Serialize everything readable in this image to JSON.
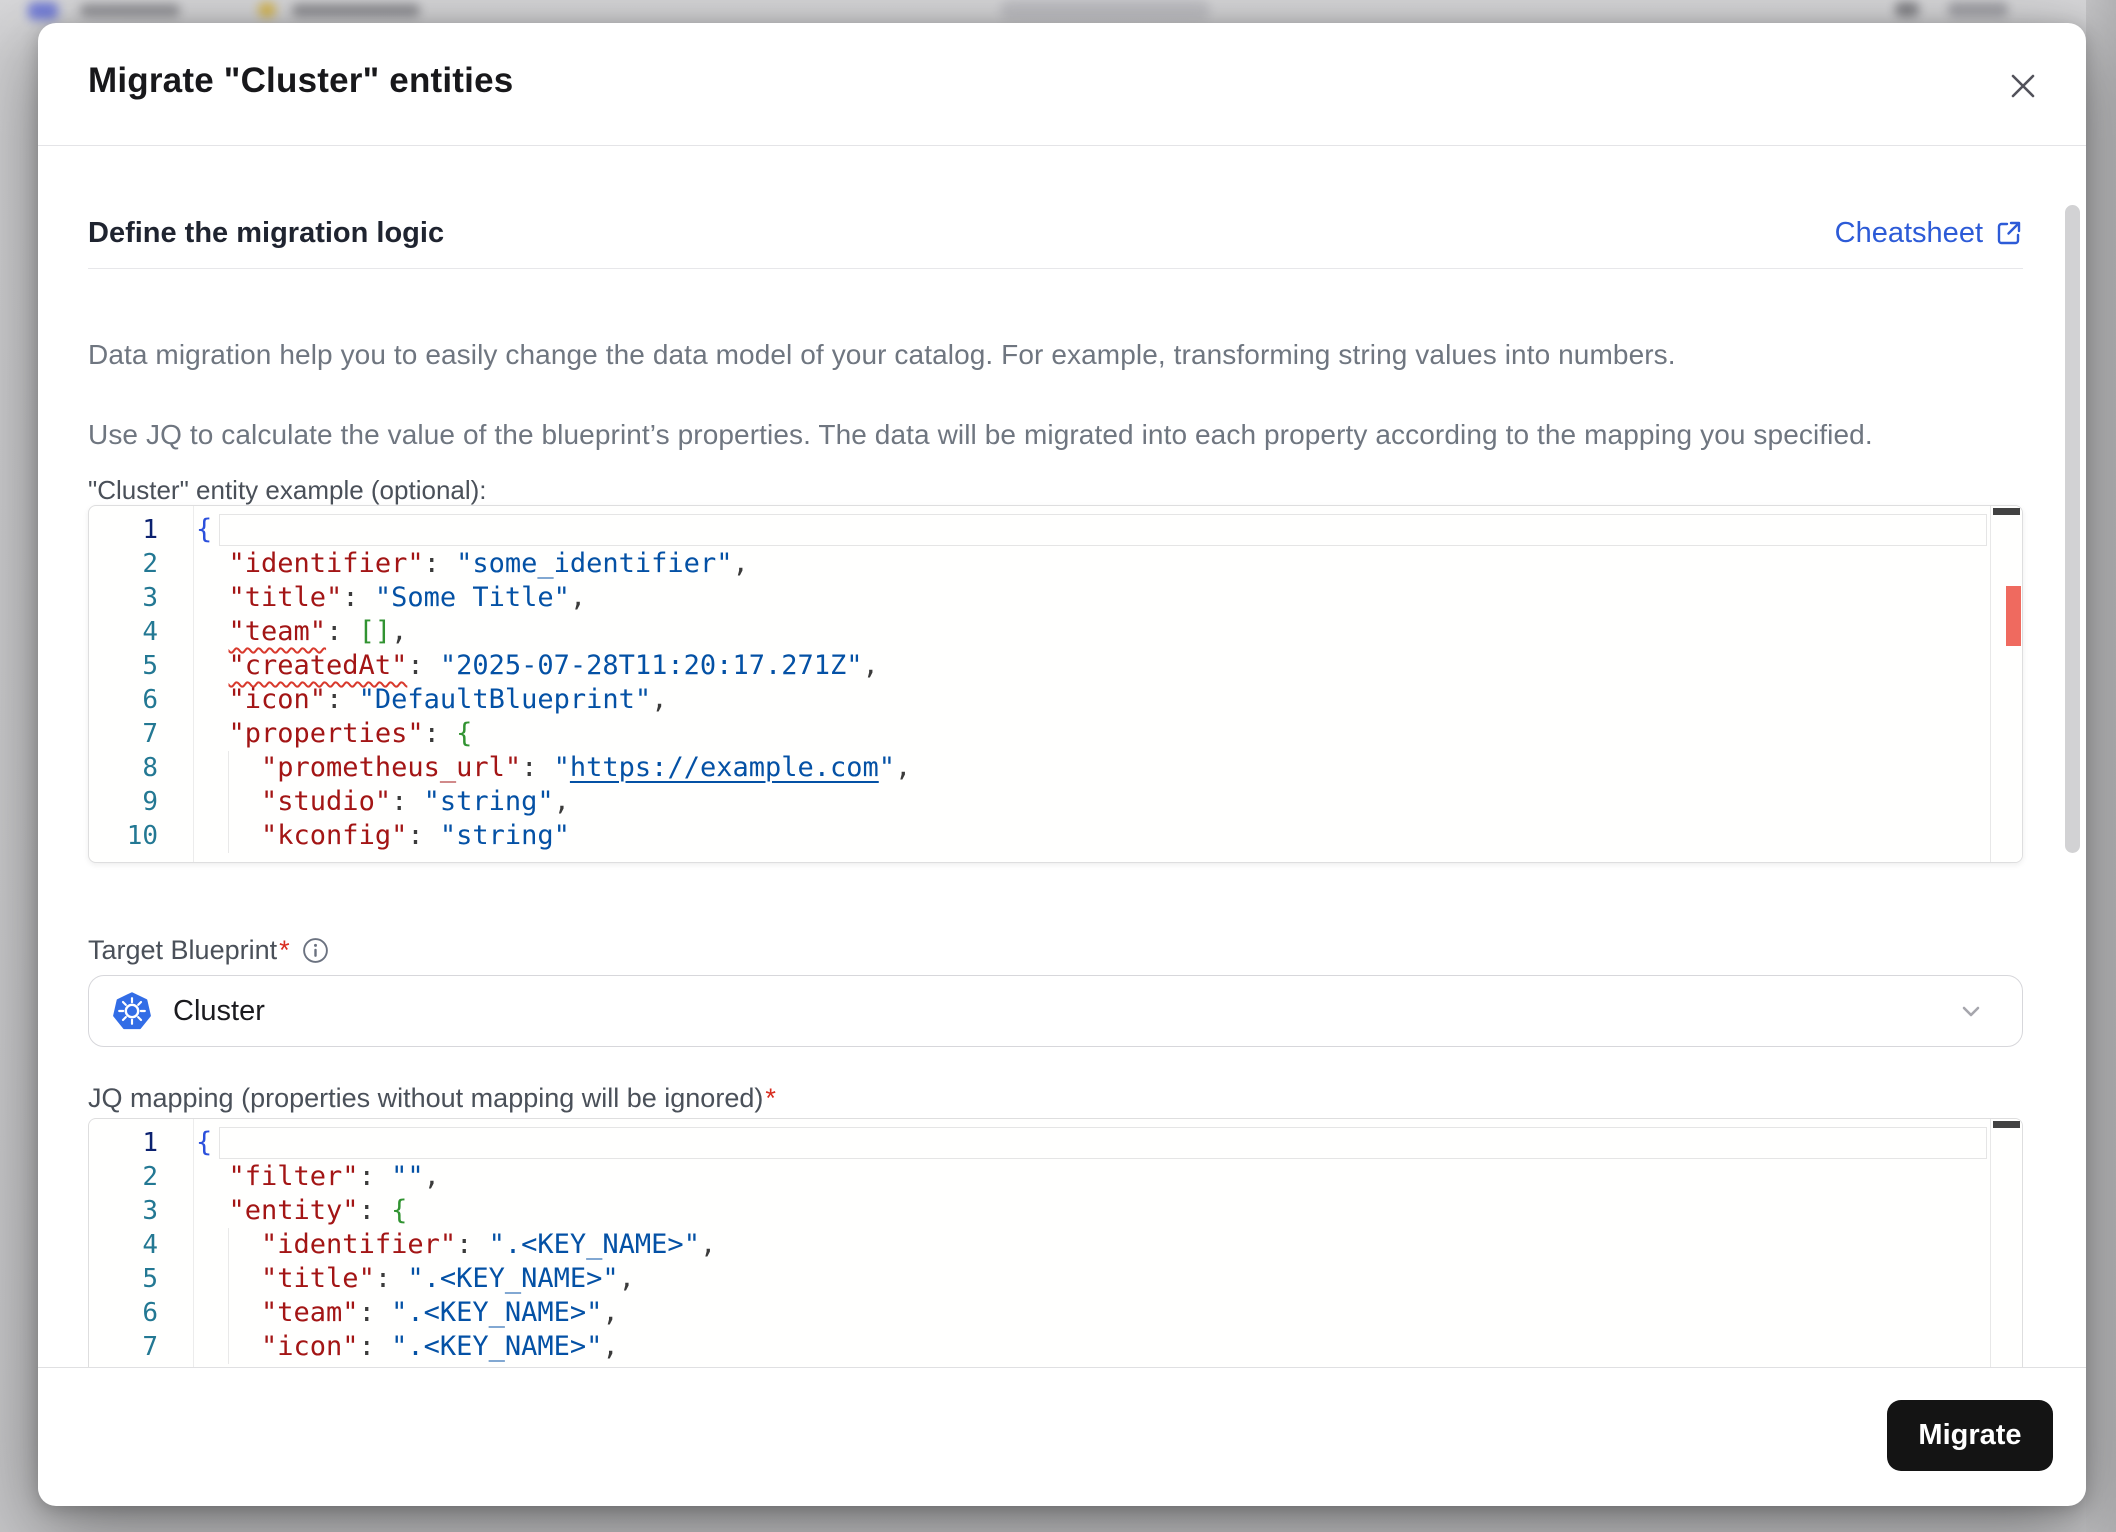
{
  "modal": {
    "title": "Migrate \"Cluster\" entities"
  },
  "section": {
    "heading": "Define the migration logic",
    "cheatsheet_label": "Cheatsheet"
  },
  "description": {
    "paragraph1": "Data migration help you to easily change the data model of your catalog. For example, transforming string values into numbers.",
    "paragraph2": "Use JQ to calculate the value of the blueprint’s properties. The data will be migrated into each property according to the mapping you specified."
  },
  "target_blueprint": {
    "label": "Target Blueprint",
    "required_marker": "*",
    "value": "Cluster",
    "icon": "kubernetes-icon"
  },
  "jq_mapping": {
    "label": "JQ mapping (properties without mapping will be ignored)",
    "required_marker": "*"
  },
  "footer": {
    "migrate_label": "Migrate"
  },
  "colors": {
    "link_blue": "#2d5bd7",
    "button_black": "#141414",
    "kubernetes_blue": "#326de6",
    "json_key_red": "#a31515",
    "json_string_blue": "#0451a5",
    "bracket_level1_blue": "#2b50dc",
    "bracket_level2_green": "#319331",
    "squiggle_red": "#d8392c",
    "error_marker_red": "#ef6a5f",
    "required_red": "#d92d20"
  },
  "editors": {
    "example": {
      "label": "\"Cluster\" entity example (optional):",
      "has_error_marker": true,
      "lines": [
        {
          "n": "1",
          "current": true,
          "tokens": [
            [
              "b0",
              "{"
            ]
          ]
        },
        {
          "n": "2",
          "tokens": [
            [
              "pu",
              "  "
            ],
            [
              "k",
              "\"identifier\""
            ],
            [
              "pu",
              ": "
            ],
            [
              "s",
              "\"some_identifier\""
            ],
            [
              "pu",
              ","
            ]
          ]
        },
        {
          "n": "3",
          "tokens": [
            [
              "pu",
              "  "
            ],
            [
              "k",
              "\"title\""
            ],
            [
              "pu",
              ": "
            ],
            [
              "s",
              "\"Some Title\""
            ],
            [
              "pu",
              ","
            ]
          ]
        },
        {
          "n": "4",
          "tokens": [
            [
              "pu",
              "  "
            ],
            [
              "ksq",
              "\"team\""
            ],
            [
              "pu",
              ": "
            ],
            [
              "b1",
              "[]"
            ],
            [
              "pu",
              ","
            ]
          ]
        },
        {
          "n": "5",
          "tokens": [
            [
              "pu",
              "  "
            ],
            [
              "ksq",
              "\"createdAt\""
            ],
            [
              "pu",
              ": "
            ],
            [
              "s",
              "\"2025-07-28T11:20:17.271Z\""
            ],
            [
              "pu",
              ","
            ]
          ]
        },
        {
          "n": "6",
          "tokens": [
            [
              "pu",
              "  "
            ],
            [
              "k",
              "\"icon\""
            ],
            [
              "pu",
              ": "
            ],
            [
              "s",
              "\"DefaultBlueprint\""
            ],
            [
              "pu",
              ","
            ]
          ]
        },
        {
          "n": "7",
          "tokens": [
            [
              "pu",
              "  "
            ],
            [
              "k",
              "\"properties\""
            ],
            [
              "pu",
              ": "
            ],
            [
              "b1",
              "{"
            ]
          ]
        },
        {
          "n": "8",
          "tokens": [
            [
              "pu",
              "    "
            ],
            [
              "k",
              "\"prometheus_url\""
            ],
            [
              "pu",
              ": "
            ],
            [
              "s",
              "\""
            ],
            [
              "slink",
              "https://example.com"
            ],
            [
              "s",
              "\""
            ],
            [
              "pu",
              ","
            ]
          ]
        },
        {
          "n": "9",
          "tokens": [
            [
              "pu",
              "    "
            ],
            [
              "k",
              "\"studio\""
            ],
            [
              "pu",
              ": "
            ],
            [
              "s",
              "\"string\""
            ],
            [
              "pu",
              ","
            ]
          ]
        },
        {
          "n": "10",
          "tokens": [
            [
              "pu",
              "    "
            ],
            [
              "k",
              "\"kconfig\""
            ],
            [
              "pu",
              ": "
            ],
            [
              "s",
              "\"string\""
            ]
          ]
        }
      ]
    },
    "jq": {
      "has_error_marker": false,
      "lines": [
        {
          "n": "1",
          "current": true,
          "tokens": [
            [
              "b0",
              "{"
            ]
          ]
        },
        {
          "n": "2",
          "tokens": [
            [
              "pu",
              "  "
            ],
            [
              "k",
              "\"filter\""
            ],
            [
              "pu",
              ": "
            ],
            [
              "s",
              "\"\""
            ],
            [
              "pu",
              ","
            ]
          ]
        },
        {
          "n": "3",
          "tokens": [
            [
              "pu",
              "  "
            ],
            [
              "k",
              "\"entity\""
            ],
            [
              "pu",
              ": "
            ],
            [
              "b1",
              "{"
            ]
          ]
        },
        {
          "n": "4",
          "tokens": [
            [
              "pu",
              "    "
            ],
            [
              "k",
              "\"identifier\""
            ],
            [
              "pu",
              ": "
            ],
            [
              "s",
              "\".<KEY_NAME>\""
            ],
            [
              "pu",
              ","
            ]
          ]
        },
        {
          "n": "5",
          "tokens": [
            [
              "pu",
              "    "
            ],
            [
              "k",
              "\"title\""
            ],
            [
              "pu",
              ": "
            ],
            [
              "s",
              "\".<KEY_NAME>\""
            ],
            [
              "pu",
              ","
            ]
          ]
        },
        {
          "n": "6",
          "tokens": [
            [
              "pu",
              "    "
            ],
            [
              "k",
              "\"team\""
            ],
            [
              "pu",
              ": "
            ],
            [
              "s",
              "\".<KEY_NAME>\""
            ],
            [
              "pu",
              ","
            ]
          ]
        },
        {
          "n": "7",
          "tokens": [
            [
              "pu",
              "    "
            ],
            [
              "k",
              "\"icon\""
            ],
            [
              "pu",
              ": "
            ],
            [
              "s",
              "\".<KEY_NAME>\""
            ],
            [
              "pu",
              ","
            ]
          ]
        }
      ]
    }
  }
}
